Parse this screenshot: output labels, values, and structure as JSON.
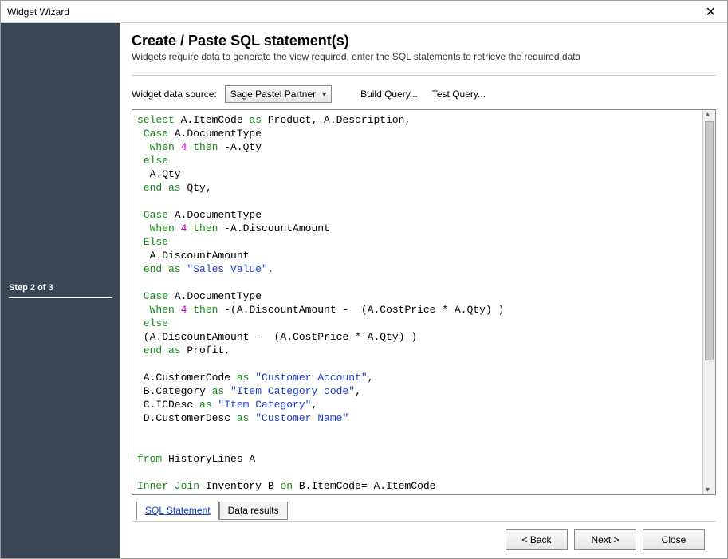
{
  "window": {
    "title": "Widget Wizard"
  },
  "sidebar": {
    "step": "Step 2 of 3"
  },
  "header": {
    "heading": "Create / Paste SQL statement(s)",
    "subheading": "Widgets require data to generate the view required, enter the SQL statements to retrieve the required data"
  },
  "toolbar": {
    "dataSourceLabel": "Widget data source:",
    "dataSourceValue": "Sage Pastel Partner",
    "buildQuery": "Build Query...",
    "testQuery": "Test Query..."
  },
  "sql": {
    "l01a": "select",
    "l01b": " A.ItemCode ",
    "l01c": "as",
    "l01d": " Product, A.Description,",
    "l02a": " Case",
    "l02b": " A.DocumentType",
    "l03a": "  when ",
    "l03n": "4",
    "l03b": " then",
    "l03c": " -A.Qty",
    "l04a": " else",
    "l05a": "  A.Qty",
    "l06a": " end as",
    "l06b": " Qty,",
    "blank1": "",
    "l08a": " Case",
    "l08b": " A.DocumentType",
    "l09a": "  When ",
    "l09n": "4",
    "l09b": " then",
    "l09c": " -A.DiscountAmount",
    "l10a": " Else",
    "l11a": "  A.DiscountAmount",
    "l12a": " end as ",
    "l12s": "\"Sales Value\"",
    "l12c": ",",
    "blank2": "",
    "l14a": " Case",
    "l14b": " A.DocumentType",
    "l15a": "  When ",
    "l15n": "4",
    "l15b": " then",
    "l15c": " -(A.DiscountAmount -  (A.CostPrice * A.Qty) )",
    "l16a": " else",
    "l17a": " (A.DiscountAmount -  (A.CostPrice * A.Qty) )",
    "l18a": " end as",
    "l18b": " Profit,",
    "blank3": "",
    "l20a": " A.CustomerCode ",
    "l20k": "as ",
    "l20s": "\"Customer Account\"",
    "l20c": ",",
    "l21a": " B.Category ",
    "l21k": "as ",
    "l21s": "\"Item Category code\"",
    "l21c": ",",
    "l22a": " C.ICDesc ",
    "l22k": "as ",
    "l22s": "\"Item Category\"",
    "l22c": ",",
    "l23a": " D.CustomerDesc ",
    "l23k": "as ",
    "l23s": "\"Customer Name\"",
    "blank4": "",
    "blank5": "",
    "l26a": "from",
    "l26b": " HistoryLines A",
    "blank6": "",
    "l28a": "Inner Join",
    "l28b": " Inventory B ",
    "l28c": "on",
    "l28d": " B.ItemCode= A.ItemCode"
  },
  "tabs": {
    "sqlStatement": "SQL Statement",
    "dataResults": "Data results"
  },
  "footer": {
    "back": "< Back",
    "next": "Next >",
    "close": "Close"
  }
}
